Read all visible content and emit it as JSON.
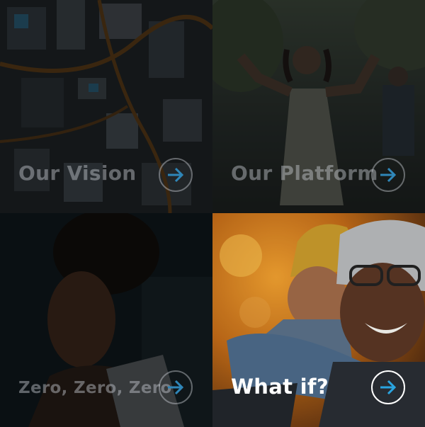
{
  "tiles": [
    {
      "label": "Our Vision",
      "icon": "arrow-right-icon",
      "active": false,
      "accent": "#3a9fd8"
    },
    {
      "label": "Our Platform",
      "icon": "arrow-right-icon",
      "active": false,
      "accent": "#3a9fd8"
    },
    {
      "label": "Zero, Zero, Zero",
      "icon": "arrow-right-icon",
      "active": false,
      "accent": "#3a9fd8"
    },
    {
      "label": "What if?",
      "icon": "arrow-right-icon",
      "active": true,
      "accent": "#2aa4e0"
    }
  ]
}
